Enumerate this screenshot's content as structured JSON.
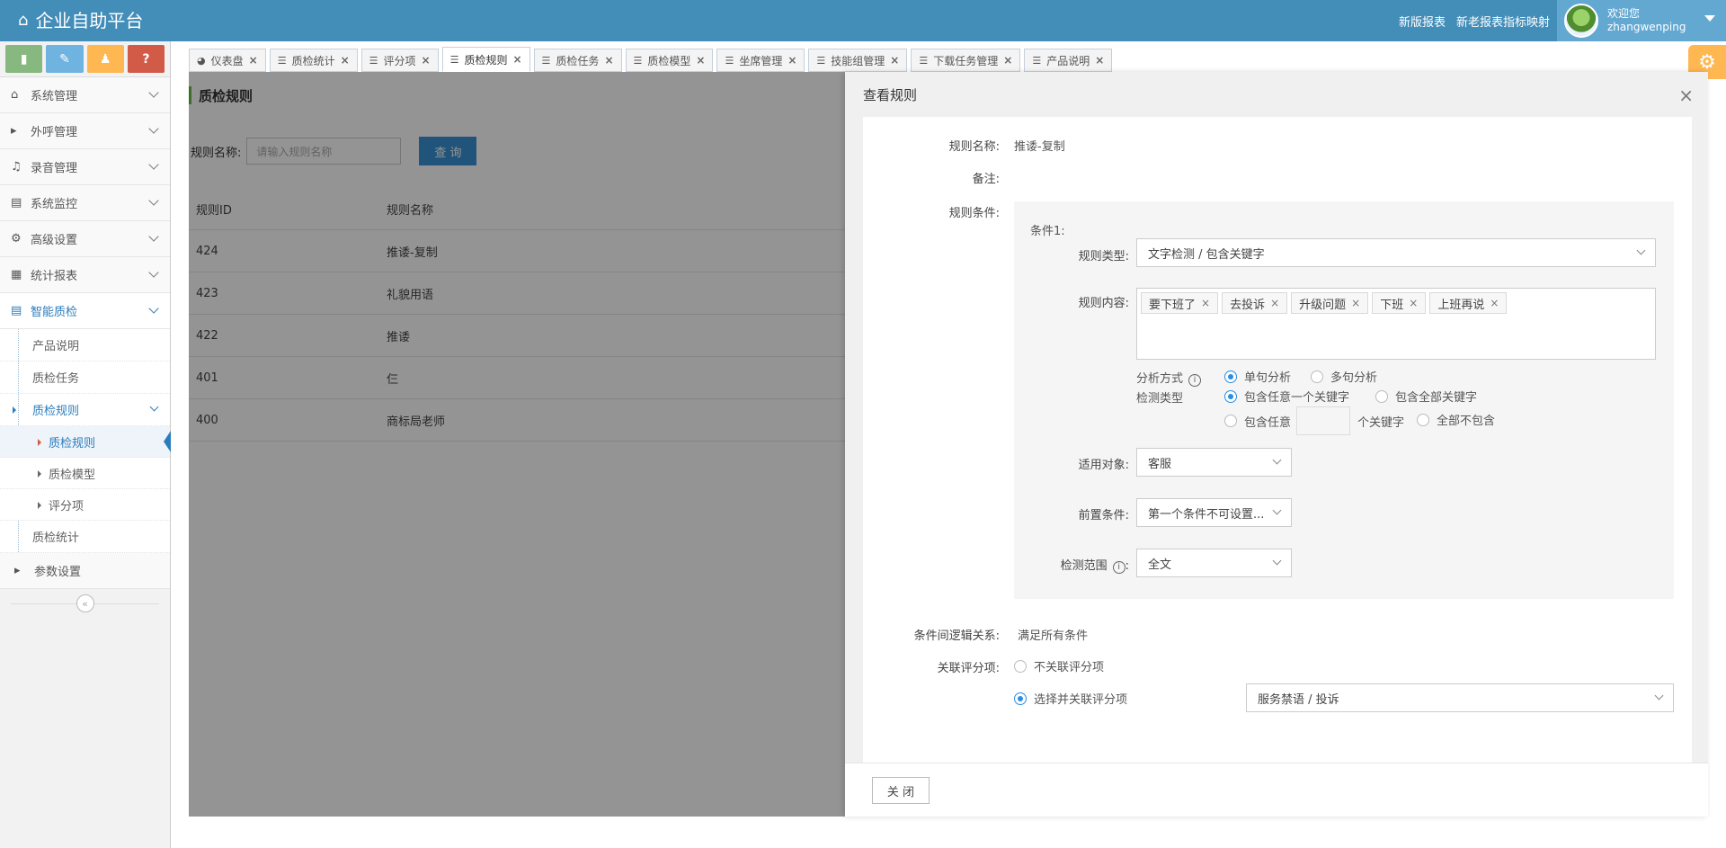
{
  "header": {
    "title": "企业自助平台",
    "links": [
      "新版报表",
      "新老报表指标映射"
    ],
    "welcome": "欢迎您",
    "username": "zhangwenping"
  },
  "sidebar": {
    "shortcuts": [
      "chart",
      "pencil",
      "users",
      "?"
    ],
    "menu": [
      {
        "label": "系统管理",
        "icon": "home-icon"
      },
      {
        "label": "外呼管理",
        "icon": "caret-right-icon"
      },
      {
        "label": "录音管理",
        "icon": "music-icon"
      },
      {
        "label": "系统监控",
        "icon": "bar-chart-icon"
      },
      {
        "label": "高级设置",
        "icon": "gears-icon"
      },
      {
        "label": "统计报表",
        "icon": "calculator-icon"
      },
      {
        "label": "智能质检",
        "icon": "bar-chart-icon"
      }
    ],
    "sub": [
      "产品说明",
      "质检任务",
      "质检规则"
    ],
    "subsub": [
      "质检规则",
      "质检模型",
      "评分项"
    ],
    "sub_after": "质检统计",
    "last": "参数设置"
  },
  "tabs": [
    {
      "label": "仪表盘",
      "icon": "dashboard-icon"
    },
    {
      "label": "质检统计"
    },
    {
      "label": "评分项"
    },
    {
      "label": "质检规则"
    },
    {
      "label": "质检任务"
    },
    {
      "label": "质检模型"
    },
    {
      "label": "坐席管理"
    },
    {
      "label": "技能组管理"
    },
    {
      "label": "下载任务管理"
    },
    {
      "label": "产品说明"
    }
  ],
  "content": {
    "title": "质检规则",
    "filter_label": "规则名称:",
    "filter_placeholder": "请输入规则名称",
    "query_button": "查 询",
    "columns": [
      "规则ID",
      "规则名称"
    ],
    "rows": [
      [
        "424",
        "推诿-复制"
      ],
      [
        "423",
        "礼貌用语"
      ],
      [
        "422",
        "推诿"
      ],
      [
        "401",
        "仨"
      ],
      [
        "400",
        "商标局老师"
      ]
    ]
  },
  "drawer": {
    "title": "查看规则",
    "close_button": "关 闭",
    "rule_name_label": "规则名称:",
    "rule_name": "推诿-复制",
    "remark_label": "备注:",
    "remark": "",
    "condition_label": "规则条件:",
    "condition_title": "条件1:",
    "rule_type_label": "规则类型:",
    "rule_type": "文字检测 / 包含关键字",
    "rule_content_label": "规则内容:",
    "keywords": [
      "要下班了",
      "去投诉",
      "升级问题",
      "下班",
      "上班再说"
    ],
    "analysis_label": "分析方式",
    "analysis_options": [
      "单句分析",
      "多句分析"
    ],
    "detect_label": "检测类型",
    "detect_options": [
      "包含任意一个关键字",
      "包含全部关键字"
    ],
    "detect_any_prefix": "包含任意",
    "detect_any_suffix": "个关键字",
    "detect_none": "全部不包含",
    "target_label": "适用对象:",
    "target": "客服",
    "precondition_label": "前置条件:",
    "precondition": "第一个条件不可设置...",
    "range_label": "检测范围",
    "range": "全文",
    "logic_label": "条件间逻辑关系:",
    "logic": "满足所有条件",
    "score_label": "关联评分项:",
    "score_options": [
      "不关联评分项",
      "选择并关联评分项"
    ],
    "score_value": "服务禁语 / 投诉"
  }
}
